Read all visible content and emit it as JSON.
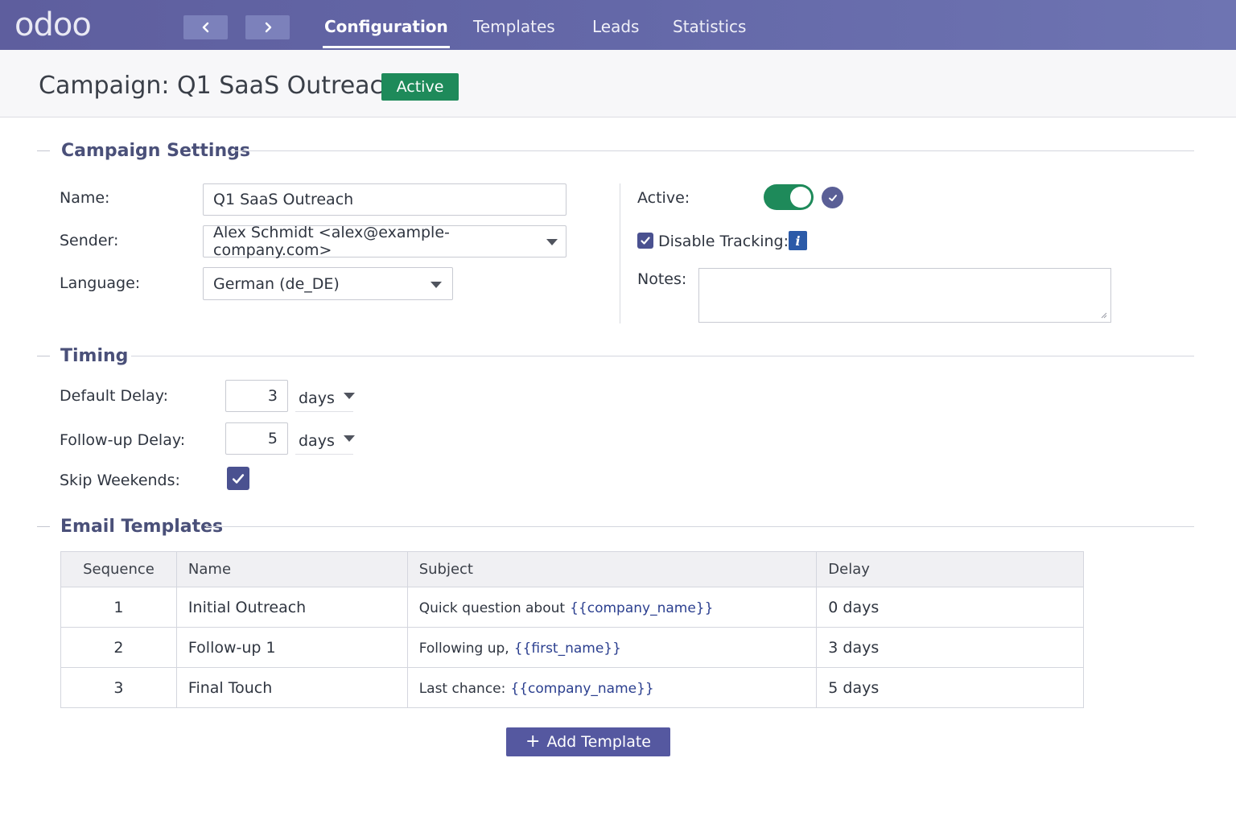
{
  "app": {
    "logo": "odoo"
  },
  "nav": {
    "tabs": [
      {
        "label": "Configuration",
        "active": true
      },
      {
        "label": "Templates",
        "active": false
      },
      {
        "label": "Leads",
        "active": false
      },
      {
        "label": "Statistics",
        "active": false
      }
    ],
    "icons": {
      "prev": "chevron-left-icon",
      "next": "chevron-right-icon"
    }
  },
  "header": {
    "title": "Campaign: Q1 SaaS Outreach",
    "status": "Active",
    "status_color": "#1e8a5a"
  },
  "settings": {
    "title": "Campaign Settings",
    "name_label": "Name:",
    "name_value": "Q1 SaaS Outreach",
    "sender_label": "Sender:",
    "sender_value": "Alex Schmidt <alex@example-company.com>",
    "language_label": "Language:",
    "language_value": "German (de_DE)",
    "active_label": "Active:",
    "active_on": true,
    "disable_tracking_label": "Disable Tracking:",
    "disable_tracking_checked": true,
    "notes_label": "Notes:",
    "notes_value": ""
  },
  "timing": {
    "title": "Timing",
    "default_delay_label": "Default Delay:",
    "default_delay_value": "3",
    "default_delay_unit": "days",
    "followup_delay_label": "Follow-up Delay:",
    "followup_delay_value": "5",
    "followup_delay_unit": "days",
    "skip_weekends_label": "Skip Weekends:",
    "skip_weekends_checked": true
  },
  "templates": {
    "title": "Email Templates",
    "columns": [
      "Sequence",
      "Name",
      "Subject",
      "Delay"
    ],
    "rows": [
      {
        "sequence": "1",
        "name": "Initial Outreach",
        "subject_text": "Quick question about",
        "subject_var": "{{company_name}}",
        "delay": "0 days"
      },
      {
        "sequence": "2",
        "name": "Follow-up 1",
        "subject_text": "Following up,",
        "subject_var": "{{first_name}}",
        "delay": "3 days"
      },
      {
        "sequence": "3",
        "name": "Final Touch",
        "subject_text": "Last chance:",
        "subject_var": "{{company_name}}",
        "delay": "5 days"
      }
    ],
    "add_button": "Add Template"
  },
  "colors": {
    "navbar": "#6468a8",
    "accent": "#5558a0",
    "success": "#1e8a5a",
    "section_title": "#4a5079"
  }
}
